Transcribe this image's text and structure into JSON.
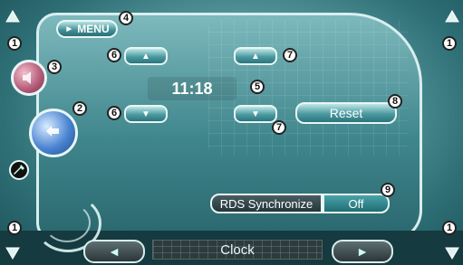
{
  "menu": {
    "label": "MENU",
    "icon": "play-triangle-icon"
  },
  "time": {
    "display": "11:18"
  },
  "buttons": {
    "hour_up_icon": "up-triangle-icon",
    "hour_down_icon": "down-triangle-icon",
    "minute_up_icon": "up-triangle-icon",
    "minute_down_icon": "down-triangle-icon",
    "reset_label": "Reset"
  },
  "rds": {
    "label": "RDS Synchronize",
    "value": "Off"
  },
  "footer": {
    "title": "Clock",
    "left_icon": "left-triangle-icon",
    "right_icon": "right-triangle-icon"
  },
  "callouts": {
    "c1": "1",
    "c2": "2",
    "c3": "3",
    "c4": "4",
    "c5": "5",
    "c6": "6",
    "c7": "7",
    "c8": "8",
    "c9": "9"
  },
  "icons": {
    "scroll_up": "up-arrow-icon",
    "scroll_down": "down-arrow-icon",
    "audio_button": "speaker-icon",
    "back_button": "return-arrow-icon",
    "settings": "wrench-icon"
  }
}
